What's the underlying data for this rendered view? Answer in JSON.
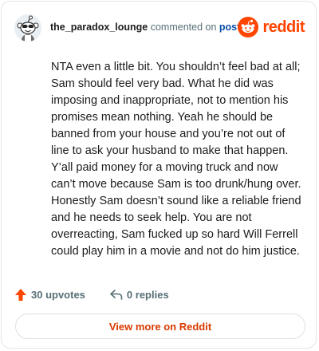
{
  "header": {
    "username": "the_paradox_lounge",
    "action_text": "commented on",
    "post_link_label": "post",
    "brand_name": "reddit"
  },
  "comment": {
    "body": "NTA even a little bit. You shouldn’t feel bad at all; Sam should feel very bad. What he did was imposing and inappropriate, not to mention his promises mean nothing. Yeah he should be banned from your house and you’re not out of line to ask your husband to make that happen. Y’all paid money for a moving truck and now can’t move because Sam is too drunk/hung over. Honestly Sam doesn’t sound like a reliable friend and he needs to seek help. You are not overreacting, Sam fucked up so hard Will Ferrell could play him in a movie and not do him justice."
  },
  "footer": {
    "upvotes_label": "30 upvotes",
    "replies_label": "0 replies"
  },
  "actions": {
    "view_more_label": "View more on Reddit"
  },
  "icons": {
    "avatar": "snoo-avatar-icon",
    "brand": "reddit-logo-icon",
    "upvote": "upvote-arrow-icon",
    "reply": "reply-arrow-icon"
  },
  "colors": {
    "brand": "#ff4500",
    "link": "#0a4fa8",
    "button_text": "#d93a00",
    "muted": "#576f76"
  }
}
